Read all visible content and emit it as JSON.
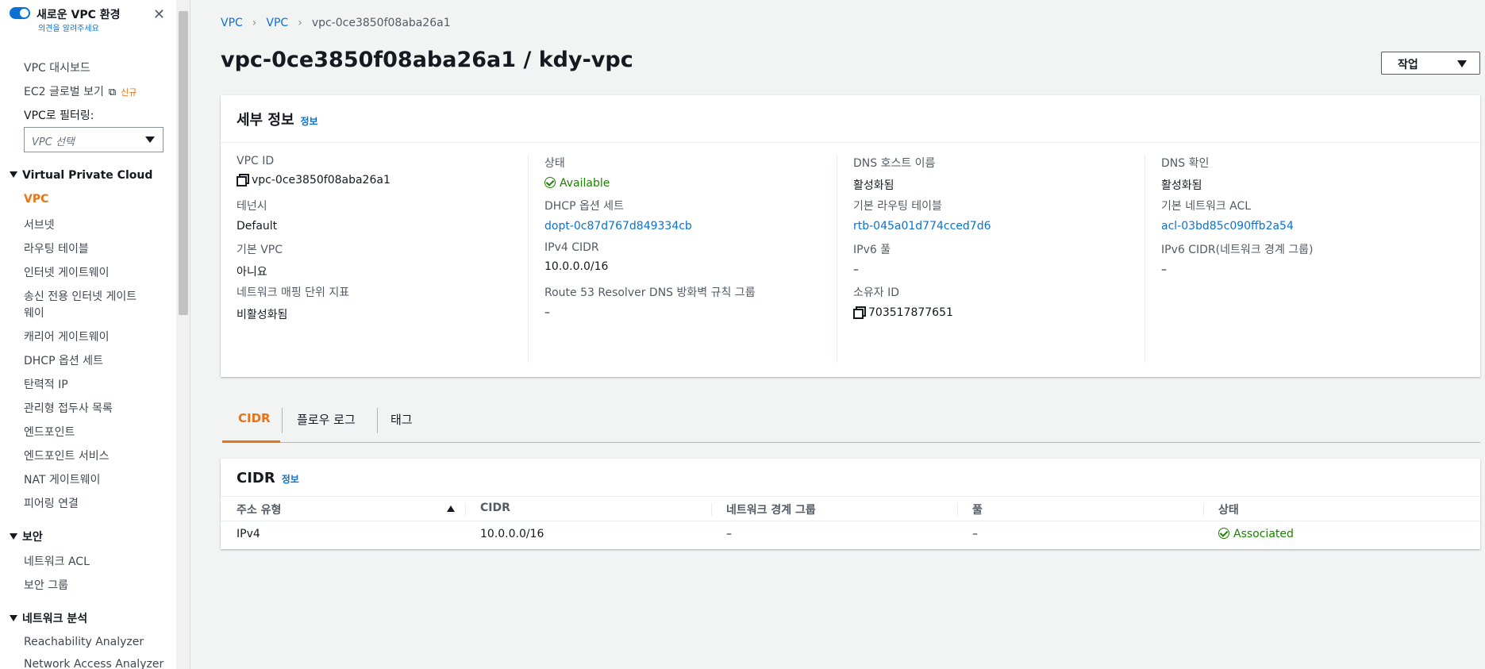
{
  "sidebar": {
    "new_vpc_label": "새로운 VPC 환경",
    "feedback_label": "의견을 알려주세요",
    "items": [
      {
        "label": "VPC 대시보드"
      },
      {
        "label": "EC2 글로벌 보기",
        "badge": "신규"
      },
      {
        "label": "VPC로 필터링:"
      },
      {
        "label": "VPC 선택"
      }
    ],
    "sections": [
      {
        "title": "Virtual Private Cloud",
        "items": [
          "VPC",
          "서브넷",
          "라우팅 테이블",
          "인터넷 게이트웨이",
          "송신 전용 인터넷 게이트",
          "웨이",
          "캐리어 게이트웨이",
          "DHCP 옵션 세트",
          "탄력적 IP",
          "관리형 접두사 목록",
          "엔드포인트",
          "엔드포인트 서비스",
          "NAT 게이트웨이",
          "피어링 연결"
        ]
      },
      {
        "title": "보안",
        "items": [
          "네트워크 ACL",
          "보안 그룹"
        ]
      },
      {
        "title": "네트워크 분석",
        "items": [
          "Reachability Analyzer",
          "Network Access Analyzer"
        ]
      }
    ],
    "active_item": "VPC"
  },
  "breadcrumb": [
    "VPC",
    "VPC",
    "vpc-0ce3850f08aba26a1"
  ],
  "page_title": "vpc-0ce3850f08aba26a1 / kdy-vpc",
  "action_button": "작업",
  "details": {
    "title": "세부 정보",
    "info": "정보",
    "columns": [
      [
        {
          "label": "VPC ID",
          "value": "vpc-0ce3850f08aba26a1"
        },
        {
          "label": "테넌시",
          "value": "Default"
        },
        {
          "label": "기본 VPC",
          "value": "아니요"
        },
        {
          "label": "네트워크 매핑 단위 지표",
          "value": "비활성화됨"
        }
      ],
      [
        {
          "label": "상태",
          "value": "Available"
        },
        {
          "label": "DHCP 옵션 세트",
          "value": "dopt-0c87d767d849334cb"
        },
        {
          "label": "IPv4 CIDR",
          "value": "10.0.0.0/16"
        },
        {
          "label": "Route 53 Resolver DNS 방화벽 규칙 그룹",
          "value": "–"
        }
      ],
      [
        {
          "label": "DNS 호스트 이름",
          "value": "활성화됨"
        },
        {
          "label": "기본 라우팅 테이블",
          "value": "rtb-045a01d774cced7d6"
        },
        {
          "label": "IPv6 풀",
          "value": "–"
        },
        {
          "label": "소유자 ID",
          "value": "703517877651"
        }
      ],
      [
        {
          "label": "DNS 확인",
          "value": "활성화됨"
        },
        {
          "label": "기본 네트워크 ACL",
          "value": "acl-03bd85c090ffb2a54"
        },
        {
          "label": "IPv6 CIDR(네트워크 경계 그룹)",
          "value": "–"
        }
      ]
    ]
  },
  "tabs": [
    "CIDR",
    "플로우 로그",
    "태그"
  ],
  "active_tab": "CIDR",
  "cidr_table": {
    "title": "CIDR",
    "info": "정보",
    "columns": [
      "주소 유형",
      "CIDR",
      "네트워크 경계 그룹",
      "풀",
      "상태"
    ],
    "rows": [
      [
        "IPv4",
        "10.0.0.0/16",
        "–",
        "–",
        "Associated"
      ]
    ]
  },
  "colors": {
    "accent": "#ec7211",
    "link": "#0972d3",
    "success": "#1d8102"
  }
}
